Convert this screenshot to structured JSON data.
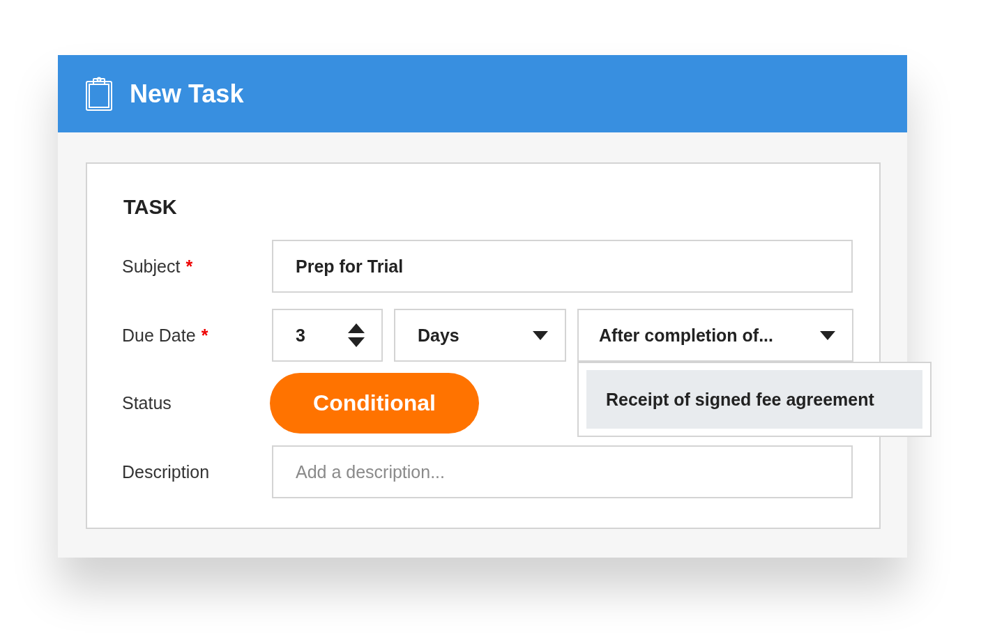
{
  "window": {
    "title": "New Task"
  },
  "section": {
    "title": "TASK"
  },
  "subject": {
    "label": "Subject",
    "required_mark": "*",
    "value": "Prep for Trial"
  },
  "due_date": {
    "label": "Due Date",
    "required_mark": "*",
    "amount": "3",
    "unit": "Days",
    "relation": "After completion of...",
    "dropdown": {
      "expanded": true,
      "options": [
        {
          "label": "Receipt of signed fee agreement",
          "selected": true
        }
      ]
    }
  },
  "status": {
    "label": "Status",
    "value": "Conditional"
  },
  "description": {
    "label": "Description",
    "placeholder": "Add a description..."
  }
}
